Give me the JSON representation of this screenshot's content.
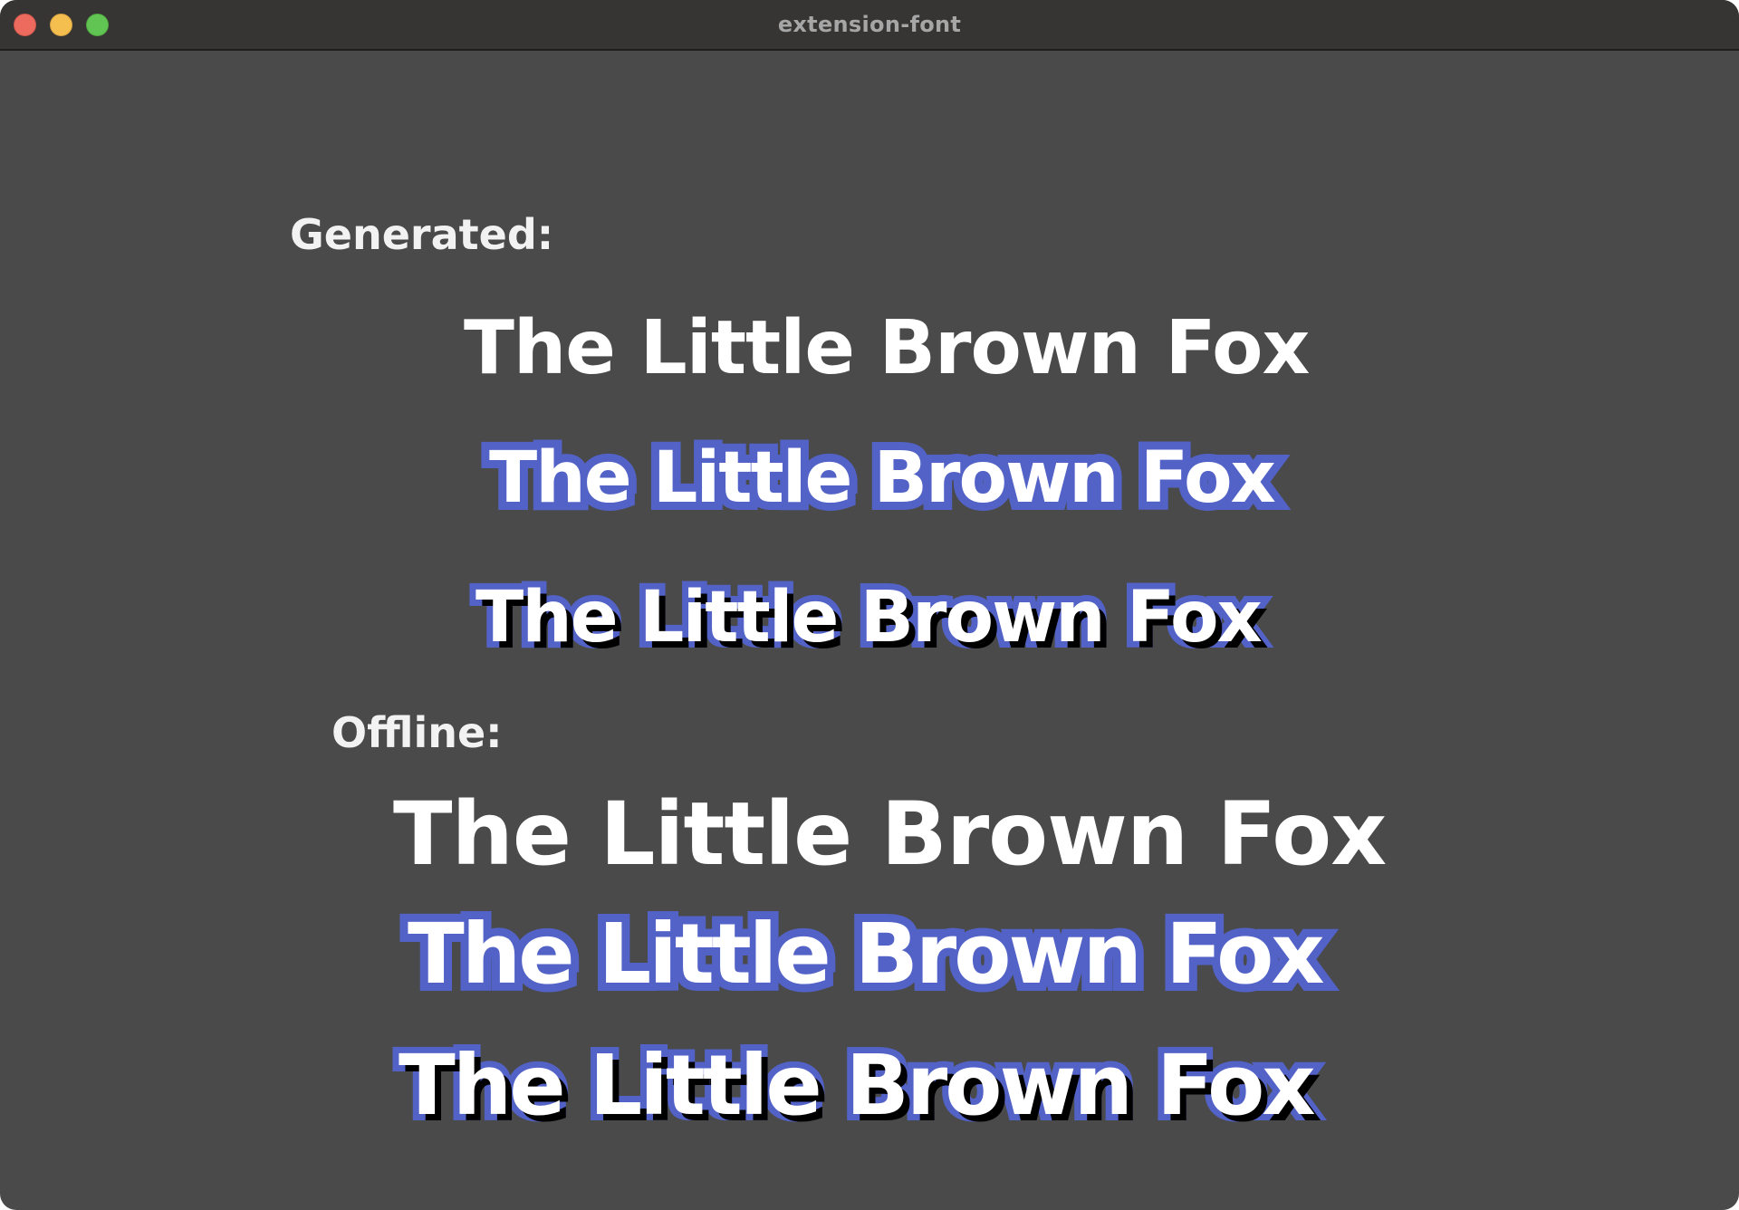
{
  "window": {
    "title": "extension-font"
  },
  "colors": {
    "background": "#4a4a4a",
    "titlebar": "#363534",
    "text": "#ffffff",
    "outline": "#5262c7",
    "shadow": "#000000"
  },
  "generated": {
    "label": "Generated:",
    "samples": [
      {
        "text": "The Little Brown Fox",
        "style": "plain"
      },
      {
        "text": "The Little Brown Fox",
        "style": "outline"
      },
      {
        "text": "The Little Brown Fox",
        "style": "outline-shadow"
      }
    ]
  },
  "offline": {
    "label": "Offline:",
    "samples": [
      {
        "text": "The Little Brown Fox",
        "style": "plain"
      },
      {
        "text": "The Little Brown Fox",
        "style": "outline"
      },
      {
        "text": "The Little Brown Fox",
        "style": "outline-shadow"
      }
    ]
  }
}
